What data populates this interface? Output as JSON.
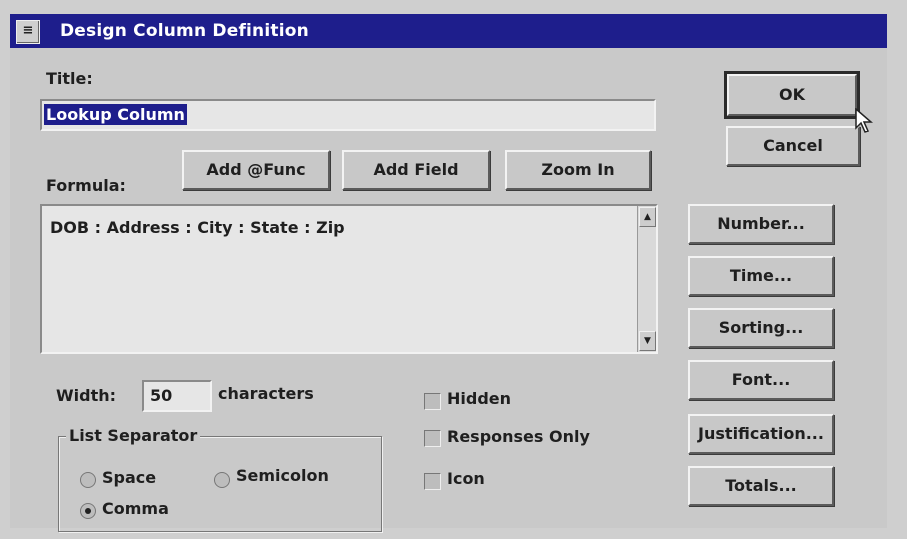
{
  "window": {
    "title": "Design Column Definition",
    "sysmenu_glyph": "≡"
  },
  "title_field": {
    "label": "Title:",
    "value": "Lookup Column"
  },
  "formula": {
    "label": "Formula:",
    "add_func": "Add @Func",
    "add_field": "Add Field",
    "zoom_in": "Zoom In",
    "value": "DOB : Address : City : State : Zip"
  },
  "width": {
    "label": "Width:",
    "value": "50",
    "unit": "characters"
  },
  "list_separator": {
    "label": "List Separator",
    "options": [
      "Space",
      "Semicolon",
      "Comma"
    ],
    "selected": "Comma"
  },
  "checkboxes": {
    "hidden": "Hidden",
    "responses_only": "Responses Only",
    "icon": "Icon"
  },
  "buttons": {
    "ok": "OK",
    "cancel": "Cancel",
    "number": "Number...",
    "time": "Time...",
    "sorting": "Sorting...",
    "font": "Font...",
    "justification": "Justification...",
    "totals": "Totals..."
  },
  "colors": {
    "titlebar": "#1e1e8c",
    "dialog": "#c9c9c9",
    "selection": "#1e1e8c"
  }
}
